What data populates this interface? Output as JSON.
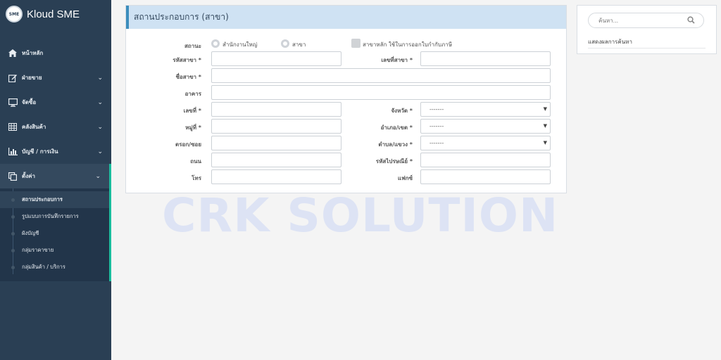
{
  "app": {
    "name": "Kloud SME",
    "logo_text": "SME"
  },
  "sidebar": {
    "items": [
      {
        "label": "หน้าหลัก",
        "icon": "home-icon"
      },
      {
        "label": "ฝ่ายขาย",
        "icon": "edit-icon"
      },
      {
        "label": "จัดซื้อ",
        "icon": "monitor-icon"
      },
      {
        "label": "คลังสินค้า",
        "icon": "table-icon"
      },
      {
        "label": "บัญชี / การเงิน",
        "icon": "bar-chart-icon"
      },
      {
        "label": "ตั้งค่า",
        "icon": "clone-icon"
      }
    ],
    "sub_items": [
      {
        "label": "สถานประกอบการ"
      },
      {
        "label": "รูปแบบการบันทึกรายการ"
      },
      {
        "label": "ผังบัญชี"
      },
      {
        "label": "กลุ่มราคาขาย"
      },
      {
        "label": "กลุ่มสินค้า / บริการ"
      }
    ]
  },
  "form": {
    "title": "สถานประกอบการ (สาขา)",
    "status_label": "สถานะ",
    "radio_head_office": "สำนักงานใหญ่",
    "radio_branch": "สาขา",
    "checkbox_main_branch": "สาขาหลัก ใช้ในการออกใบกำกับภาษี",
    "branch_code_label": "รหัสสาขา *",
    "branch_number_label": "เลขที่สาขา *",
    "branch_name_label": "ชื่อสาขา *",
    "building_label": "อาคาร",
    "address_no_label": "เลขที่ *",
    "province_label": "จังหวัด *",
    "moo_label": "หมู่ที่ *",
    "district_label": "อำเภอ/เขต *",
    "soi_label": "ตรอก/ซอย",
    "subdistrict_label": "ตำบล/แขวง *",
    "road_label": "ถนน",
    "postal_label": "รหัสไปรษณีย์ *",
    "phone_label": "โทร",
    "fax_label": "แฟกซ์",
    "select_placeholder": "-------"
  },
  "search": {
    "placeholder": "ค้นหา...",
    "results_label": "แสดงผลการค้นหา"
  },
  "watermark": "CRK SOLUTION"
}
